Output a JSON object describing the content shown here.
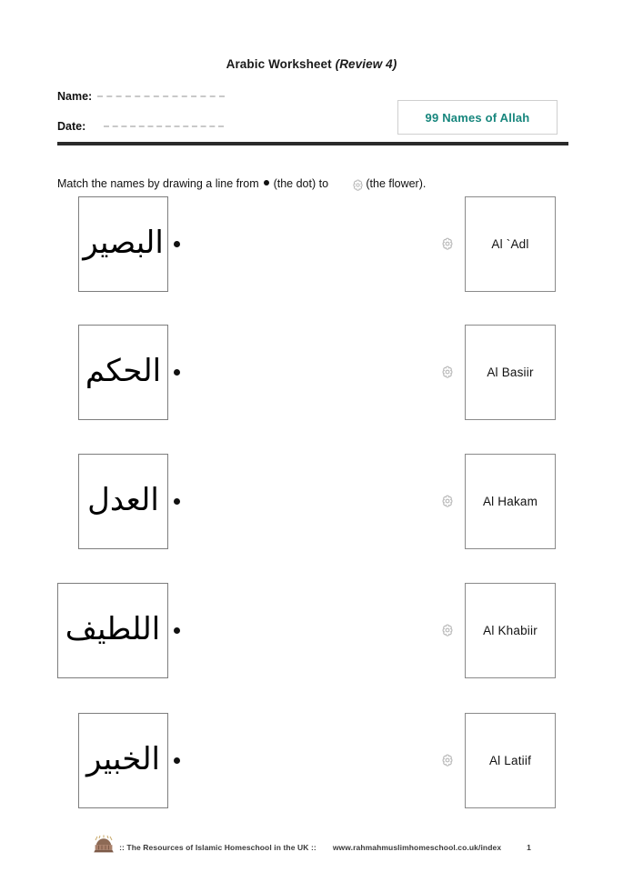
{
  "header": {
    "title_main": "Arabic Worksheet ",
    "title_review": "(Review 4)",
    "name_label": "Name:",
    "date_label": "Date:",
    "badge_label": "99 Names of Allah",
    "badge_color": "#17867d"
  },
  "instruction": {
    "part1": "Match the names by drawing a line from ",
    "part2": " (the dot) to ",
    "part3": "(the flower).",
    "dot_icon": "dot-icon",
    "flower_icon": "flower-icon"
  },
  "rows": [
    {
      "arabic": "البصير",
      "english": "Al `Adl"
    },
    {
      "arabic": "الحكم",
      "english": "Al Basiir"
    },
    {
      "arabic": "العدل",
      "english": "Al Hakam"
    },
    {
      "arabic": "اللطيف",
      "english": "Al Khabiir"
    },
    {
      "arabic": "الخبير",
      "english": "Al Latiif"
    }
  ],
  "footer": {
    "credit": ":: The Resources of Islamic Homeschool in the UK ::",
    "url": "www.rahmahmuslimhomeschool.co.uk/index",
    "page_number": "1",
    "logo_icon": "mosque-dome-icon"
  }
}
